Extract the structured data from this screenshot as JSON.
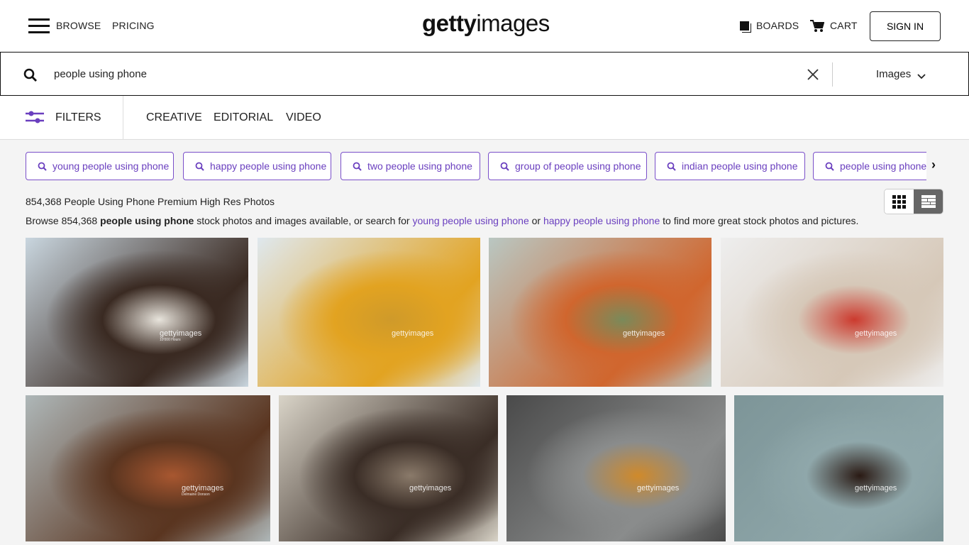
{
  "header": {
    "browse": "BROWSE",
    "pricing": "PRICING",
    "logo_bold": "getty",
    "logo_light": "images",
    "boards": "BOARDS",
    "cart": "CART",
    "sign_in": "SIGN IN"
  },
  "search": {
    "query": "people using phone",
    "type_select": "Images"
  },
  "filters": {
    "label": "FILTERS",
    "tabs": [
      "CREATIVE",
      "EDITORIAL",
      "VIDEO"
    ]
  },
  "related_searches": [
    "young people using phone",
    "happy people using phone",
    "two people using phone",
    "group of people using phone",
    "indian people using phone",
    "people using phone"
  ],
  "results": {
    "title": "854,368 People Using Phone Premium High Res Photos",
    "desc_pre": "Browse 854,368 ",
    "desc_bold": "people using phone",
    "desc_mid": " stock photos and images available, or search for ",
    "link1": "young people using phone",
    "desc_or": " or ",
    "link2": "happy people using phone",
    "desc_post": " to find more great stock photos and pictures."
  },
  "view_modes": [
    "grid-icon",
    "mosaic-icon"
  ],
  "accent_color": "#6a3fbf",
  "images": [
    {
      "colors": [
        "#c9d6df",
        "#3a2a22",
        "#e8e4dc"
      ],
      "watermark": "gettyimages",
      "credit": "10'000 Hours"
    },
    {
      "colors": [
        "#dfe8ee",
        "#e2a321",
        "#cf9a2a"
      ],
      "watermark": "gettyimages",
      "credit": ""
    },
    {
      "colors": [
        "#b9c7c2",
        "#d0662e",
        "#7a8a5a"
      ],
      "watermark": "gettyimages",
      "credit": ""
    },
    {
      "colors": [
        "#eeeeee",
        "#d6c8b8",
        "#cc3a2e"
      ],
      "watermark": "gettyimages",
      "credit": ""
    },
    {
      "colors": [
        "#aeb7b8",
        "#5a3520",
        "#a85730"
      ],
      "watermark": "gettyimages",
      "credit": "Delmaine Donson"
    },
    {
      "colors": [
        "#d9d4c8",
        "#3a2d26",
        "#8a7a6a"
      ],
      "watermark": "gettyimages",
      "credit": ""
    },
    {
      "colors": [
        "#4a4a4a",
        "#8a8c8c",
        "#d08a2a"
      ],
      "watermark": "gettyimages",
      "credit": ""
    },
    {
      "colors": [
        "#7d9598",
        "#8fa7aa",
        "#2a1a14"
      ],
      "watermark": "gettyimages",
      "credit": ""
    }
  ]
}
